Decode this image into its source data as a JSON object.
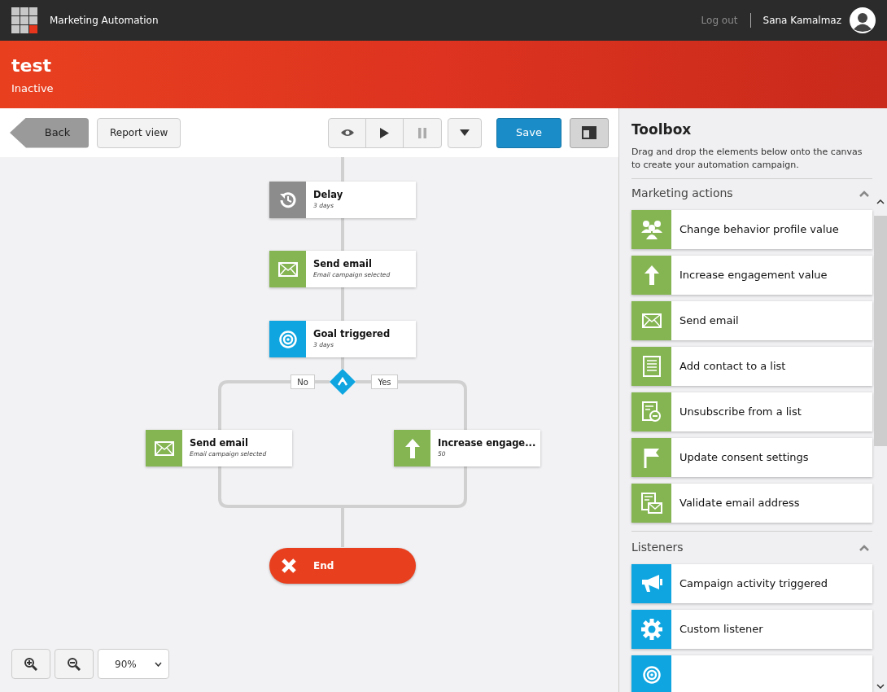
{
  "app": {
    "title": "Marketing Automation",
    "logout": "Log out",
    "user": "Sana Kamalmaz"
  },
  "campaign": {
    "name": "test",
    "status": "Inactive"
  },
  "toolbar": {
    "back": "Back",
    "report": "Report view",
    "save": "Save",
    "pause_disabled": true
  },
  "flow": {
    "nodes": [
      {
        "kind": "delay",
        "title": "Delay",
        "detail": "3 days"
      },
      {
        "kind": "action",
        "title": "Send email",
        "detail": "Email campaign selected"
      },
      {
        "kind": "listener",
        "title": "Goal triggered",
        "detail": "3 days"
      },
      {
        "kind": "action",
        "title": "Send email",
        "detail": "Email campaign selected"
      },
      {
        "kind": "action",
        "title": "Increase engage...",
        "detail": "50"
      }
    ],
    "branch_no": "No",
    "branch_yes": "Yes",
    "end": "End"
  },
  "zoom": {
    "value": "90%"
  },
  "toolbox": {
    "title": "Toolbox",
    "description": "Drag and drop the elements below onto the canvas to create your automation campaign.",
    "sections": [
      {
        "title": "Marketing actions",
        "expanded": true,
        "items": [
          {
            "kind": "action",
            "label": "Change behavior profile value"
          },
          {
            "kind": "action",
            "label": "Increase engagement value"
          },
          {
            "kind": "action",
            "label": "Send email"
          },
          {
            "kind": "action",
            "label": "Add contact to a list"
          },
          {
            "kind": "action",
            "label": "Unsubscribe from a list"
          },
          {
            "kind": "action",
            "label": "Update consent settings"
          },
          {
            "kind": "action",
            "label": "Validate email address"
          }
        ]
      },
      {
        "title": "Listeners",
        "expanded": true,
        "items": [
          {
            "kind": "listener",
            "label": "Campaign activity triggered"
          },
          {
            "kind": "listener",
            "label": "Custom listener"
          },
          {
            "kind": "listener"
          }
        ]
      }
    ]
  }
}
